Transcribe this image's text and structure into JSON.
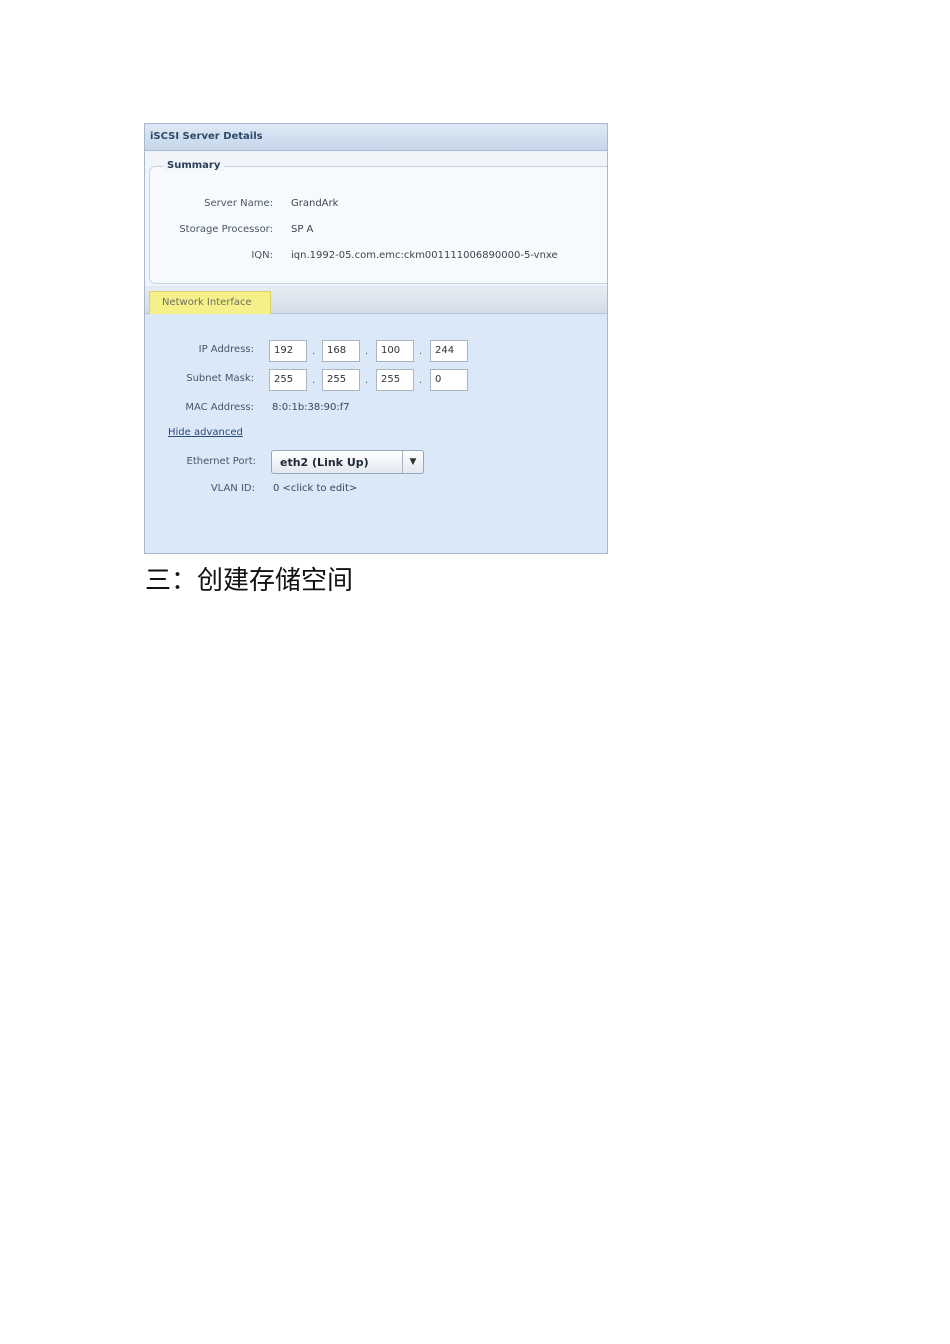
{
  "window": {
    "title": "iSCSI Server Details"
  },
  "summary": {
    "legend": "Summary",
    "server_name_label": "Server Name:",
    "server_name_value": "GrandArk",
    "sp_label": "Storage Processor:",
    "sp_value": "SP A",
    "iqn_label": "IQN:",
    "iqn_value": "iqn.1992-05.com.emc:ckm001111006890000-5-vnxe"
  },
  "tabs": [
    {
      "label": "Network Interface",
      "active": true,
      "highlight": "#f6f08a"
    }
  ],
  "network": {
    "ip_label": "IP Address:",
    "ip": [
      "192",
      "168",
      "100",
      "244"
    ],
    "subnet_label": "Subnet Mask:",
    "subnet": [
      "255",
      "255",
      "255",
      "0"
    ],
    "octet_separator": ".",
    "mac_label": "MAC Address:",
    "mac_value": "8:0:1b:38:90:f7",
    "hide_advanced_label": "Hide advanced",
    "port_label": "Ethernet Port:",
    "port_selected": "eth2 (Link Up)",
    "port_arrow": "▼",
    "vlan_label": "VLAN ID:",
    "vlan_value": "0 <click to edit>"
  },
  "caption": "三：创建存储空间"
}
